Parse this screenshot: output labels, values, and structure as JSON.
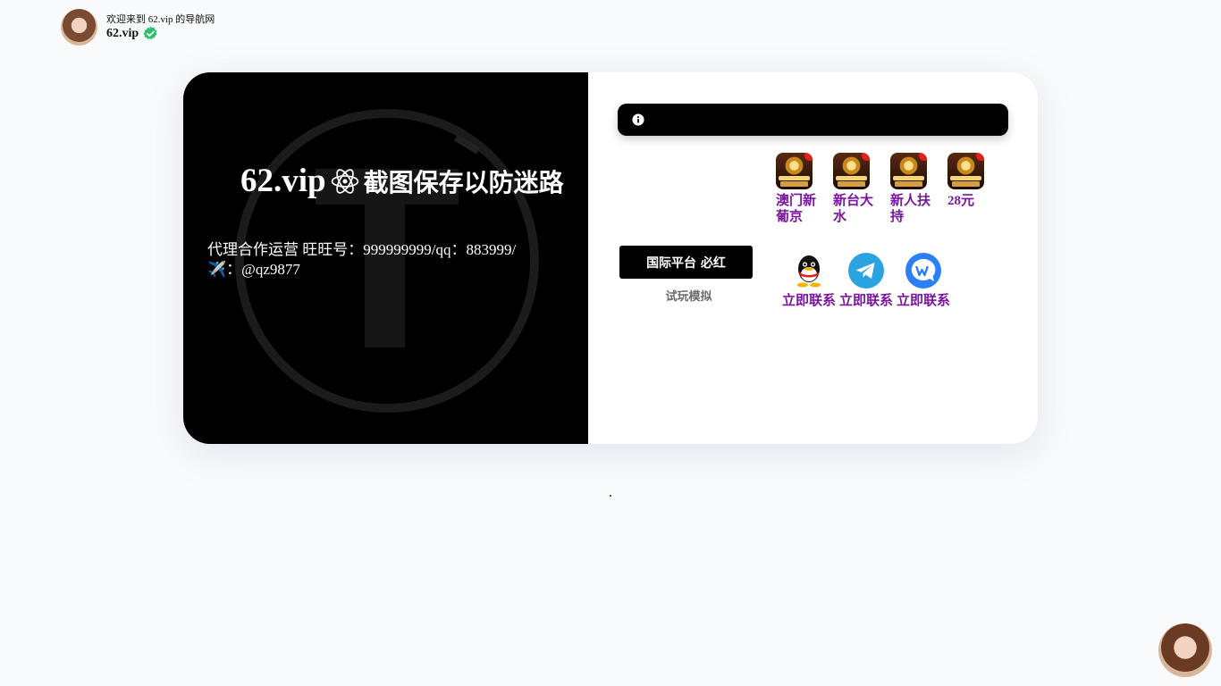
{
  "header": {
    "welcome": "欢迎来到 62.vip 的导航网",
    "site_name": "62.vip"
  },
  "left_panel": {
    "brand": "62.vip",
    "slogan": "截图保存以防迷路",
    "agent_info": "代理合作运营 旺旺号：999999999/qq：883999/✈️：@qz9877"
  },
  "apps": [
    {
      "label": "澳门新葡京",
      "icon": "app-icon"
    },
    {
      "label": "新台大水",
      "icon": "app-icon"
    },
    {
      "label": "新人扶持",
      "icon": "app-icon"
    },
    {
      "label": "28元",
      "icon": "app-icon"
    }
  ],
  "platform_button": "国际平台 必红",
  "demo_link": "试玩模拟",
  "contacts": [
    {
      "label": "立即联系",
      "icon": "qq-icon"
    },
    {
      "label": "立即联系",
      "icon": "telegram-icon"
    },
    {
      "label": "立即联系",
      "icon": "chat-icon"
    }
  ],
  "footer_dot": ".",
  "colors": {
    "accent": "#7a16a0",
    "panel": "#000000",
    "verified": "#2fbf71",
    "telegram": "#2aa3e0",
    "chat": "#2d7ff9"
  }
}
